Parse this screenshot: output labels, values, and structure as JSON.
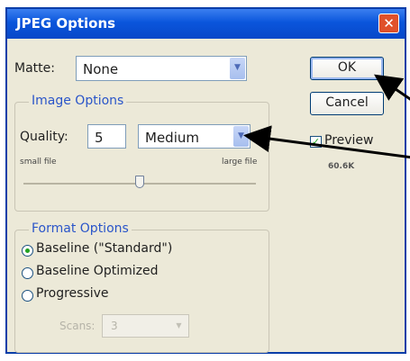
{
  "dialog": {
    "title": "JPEG Options",
    "matte": {
      "label": "Matte:",
      "value": "None"
    },
    "image_options": {
      "legend": "Image Options",
      "quality_label": "Quality:",
      "quality_value": "5",
      "quality_preset": "Medium",
      "small_file": "small file",
      "large_file": "large file",
      "slider_level": 0.5
    },
    "format_options": {
      "legend": "Format Options",
      "items": [
        "Baseline (\"Standard\")",
        "Baseline Optimized",
        "Progressive"
      ],
      "selected_index": 0,
      "scans_label": "Scans:",
      "scans_value": "3"
    },
    "buttons": {
      "ok": "OK",
      "cancel": "Cancel"
    },
    "preview": {
      "label": "Preview",
      "checked": true,
      "file_size": "60.6K"
    }
  }
}
